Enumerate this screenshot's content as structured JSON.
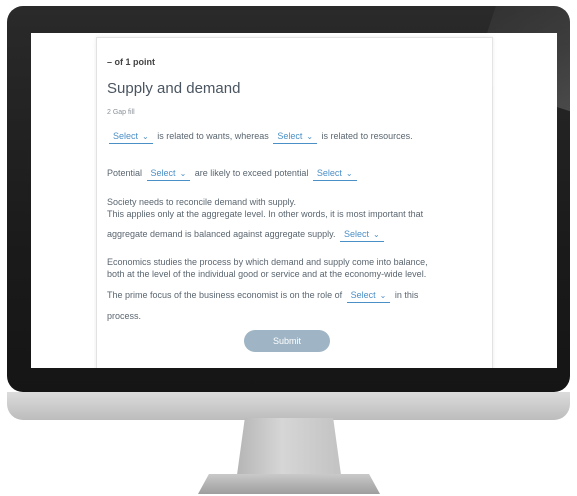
{
  "question": {
    "points": "– of 1 point",
    "title": "Supply and demand",
    "subtitle": "2 Gap fill",
    "submit_label": "Submit",
    "select_placeholder": "Select",
    "lines": {
      "l1_middle": "is related to wants, whereas",
      "l1_end": "is related to resources.",
      "l2_start": "Potential",
      "l2_middle": "are likely to exceed potential",
      "l3": "Society needs to reconcile demand with supply.",
      "l4": "This applies only at the aggregate level. In other words, it is most important that",
      "l5": "aggregate demand is balanced against aggregate supply.",
      "l6": "Economics studies the process by which demand and supply come into balance,",
      "l7": "both at the level of the individual good or service and at the economy-wide level.",
      "l8_start": "The prime focus of the business economist is on the role of",
      "l8_end": "in this",
      "l9": "process."
    }
  },
  "icons": {
    "chevron": "chevron-down-icon"
  },
  "colors": {
    "accent": "#4b8fc7",
    "submit_bg": "#9fb5c5",
    "bezel": "#1b1b1b"
  }
}
